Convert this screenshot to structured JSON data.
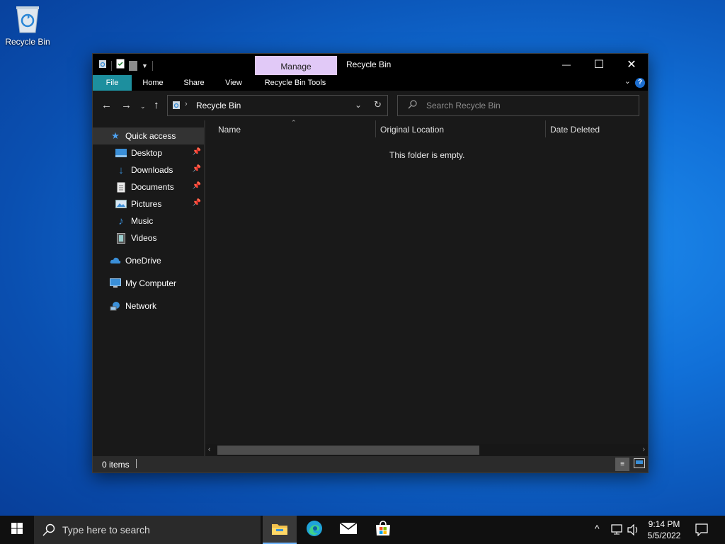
{
  "desktop": {
    "icons": [
      {
        "label": "Recycle Bin",
        "icon": "recycle-bin-icon"
      }
    ]
  },
  "window": {
    "title": "Recycle Bin",
    "contextual_tab": "Manage",
    "ribbon_tabs": [
      "File",
      "Home",
      "Share",
      "View",
      "Recycle Bin Tools"
    ],
    "controls": {
      "minimize": "—",
      "maximize": "☐",
      "close": "✕"
    },
    "help": "?",
    "address": {
      "location": "Recycle Bin",
      "icon": "recycle-bin-icon"
    },
    "search": {
      "placeholder": "Search Recycle Bin"
    },
    "nav": {
      "quick_access": "Quick access",
      "items": [
        {
          "label": "Desktop",
          "pinned": true
        },
        {
          "label": "Downloads",
          "pinned": true
        },
        {
          "label": "Documents",
          "pinned": true
        },
        {
          "label": "Pictures",
          "pinned": true
        },
        {
          "label": "Music",
          "pinned": false
        },
        {
          "label": "Videos",
          "pinned": false
        }
      ],
      "onedrive": "OneDrive",
      "my_computer": "My Computer",
      "network": "Network"
    },
    "columns": [
      "Name",
      "Original Location",
      "Date Deleted"
    ],
    "empty_message": "This folder is empty.",
    "status": "0 items",
    "colors": {
      "file_tab": "#1d8f9e",
      "manage_tab": "#e1c9f7",
      "window_bg": "#191919"
    }
  },
  "taskbar": {
    "search_placeholder": "Type here to search",
    "apps": [
      "file-explorer-icon",
      "edge-icon",
      "mail-icon",
      "store-icon"
    ],
    "time": "9:14 PM",
    "date": "5/5/2022"
  }
}
